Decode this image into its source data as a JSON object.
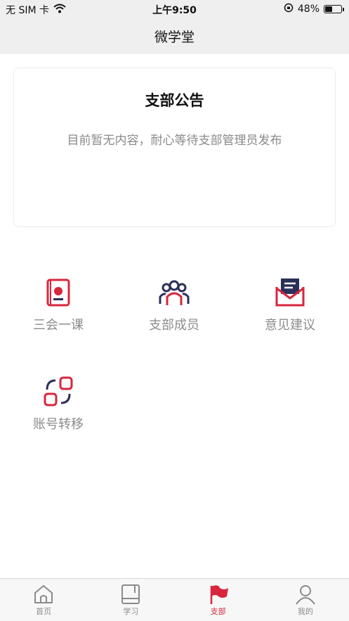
{
  "status_bar": {
    "carrier": "无 SIM 卡",
    "time": "上午9:50",
    "battery_percent": "48%",
    "battery_level": 0.48
  },
  "nav": {
    "title": "微学堂"
  },
  "notice": {
    "title": "支部公告",
    "empty_text": "目前暂无内容，耐心等待支部管理员发布"
  },
  "functions": [
    {
      "label": "三会一课",
      "icon": "party-book-icon"
    },
    {
      "label": "支部成员",
      "icon": "members-icon"
    },
    {
      "label": "意见建议",
      "icon": "mail-icon"
    },
    {
      "label": "账号转移",
      "icon": "account-transfer-icon"
    }
  ],
  "tabs": [
    {
      "label": "首页",
      "icon": "home-icon",
      "active": false
    },
    {
      "label": "学习",
      "icon": "book-icon",
      "active": false
    },
    {
      "label": "支部",
      "icon": "flag-icon",
      "active": true
    },
    {
      "label": "我的",
      "icon": "user-icon",
      "active": false
    }
  ],
  "colors": {
    "accent_red": "#d7263d",
    "navy": "#2b2f5a",
    "bar_gray": "#efefef",
    "muted_text": "#8c8c8c"
  }
}
